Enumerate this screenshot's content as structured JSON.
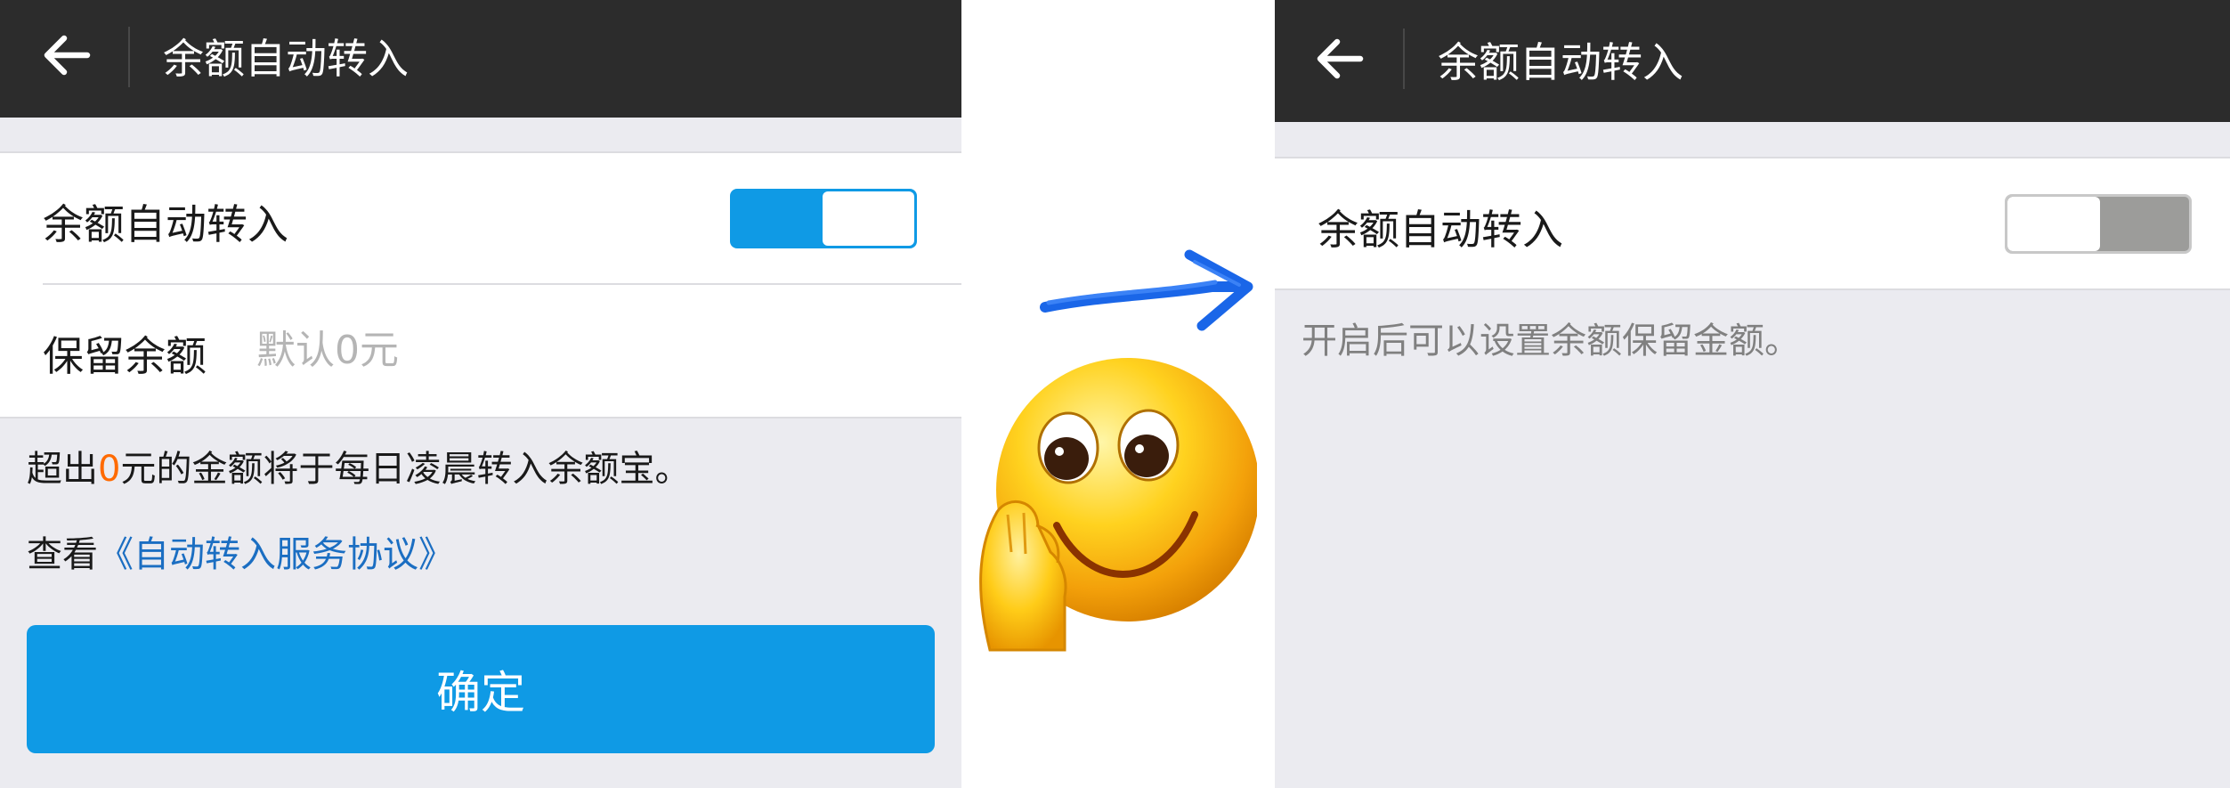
{
  "left_screen": {
    "header": {
      "back_icon": "arrow-left-icon",
      "title": "余额自动转入"
    },
    "auto_transfer": {
      "label": "余额自动转入",
      "switch_state": "on"
    },
    "keep_balance": {
      "label": "保留余额",
      "placeholder": "默认0元",
      "value": ""
    },
    "note": {
      "prefix": "超出",
      "amount": "0",
      "suffix": "元的金额将于每日凌晨转入余额宝。"
    },
    "agreement": {
      "prefix": "查看",
      "link_text": "《自动转入服务协议》"
    },
    "confirm_label": "确定"
  },
  "middle": {
    "arrow_icon": "hand-drawn-arrow-right-icon",
    "emoji_icon": "smiley-hand-on-cheek-emoji"
  },
  "right_screen": {
    "header": {
      "back_icon": "arrow-left-icon",
      "title": "余额自动转入"
    },
    "auto_transfer": {
      "label": "余额自动转入",
      "switch_state": "off"
    },
    "hint": "开启后可以设置余额保留金额。"
  },
  "colors": {
    "header_bg": "#2c2c2c",
    "page_bg": "#ebebf0",
    "accent_blue": "#0f9ae5",
    "link_blue": "#1b6ec2",
    "amount_orange": "#ff6a00",
    "switch_off_gray": "#9c9c9a"
  }
}
